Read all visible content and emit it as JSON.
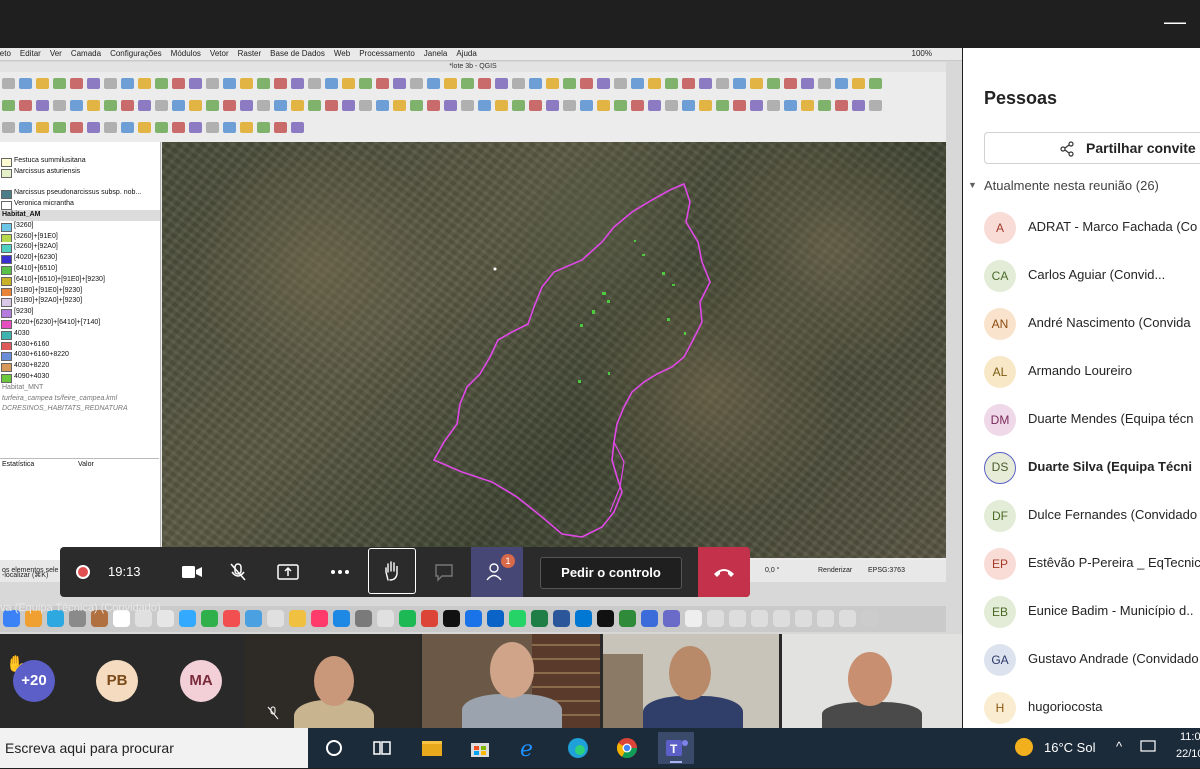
{
  "window": {
    "minimize_glyph": "—"
  },
  "mac_menu": {
    "items": [
      "ieto",
      "Editar",
      "Ver",
      "Camada",
      "Configurações",
      "Módulos",
      "Vetor",
      "Raster",
      "Base de Dados",
      "Web",
      "Processamento",
      "Janela",
      "Ajuda"
    ],
    "battery": "100%"
  },
  "qgis": {
    "title": "*lote 3b - QGIS",
    "layers": [
      {
        "label": "Festuca summilusitana",
        "color": "#fffbd0"
      },
      {
        "label": "Narcissus asturiensis",
        "color": "#e6f0c8"
      },
      {
        "label": "",
        "color": ""
      },
      {
        "label": "Narcissus pseudonarcissus subsp. nob...",
        "color": "#4a7f8a"
      },
      {
        "label": "Veronica micrantha",
        "color": "#ffffff"
      }
    ],
    "group_label": "Habitat_AM",
    "habitat_items": [
      {
        "label": "[3260]",
        "color": "#6cc6e8"
      },
      {
        "label": "[3260]+[91E0]",
        "color": "#b5d94a"
      },
      {
        "label": "[3260]+[92A0]",
        "color": "#4fd0c0"
      },
      {
        "label": "[4020]+[6230]",
        "color": "#3a2fd0"
      },
      {
        "label": "[6410]+[6510]",
        "color": "#5ac04a"
      },
      {
        "label": "[6410]+[6510]+[91E0]+[9230]",
        "color": "#c9b12a"
      },
      {
        "label": "[91B0]+[91E0]+[9230]",
        "color": "#e8833a"
      },
      {
        "label": "[91B0]+[92A0]+[9230]",
        "color": "#d9c7e8"
      },
      {
        "label": "[9230]",
        "color": "#b57ce0"
      },
      {
        "label": "4020+[6230]+[6410]+[7140]",
        "color": "#e64fbf"
      },
      {
        "label": "4030",
        "color": "#3fb3b0"
      },
      {
        "label": "4030+6160",
        "color": "#e05a5a"
      },
      {
        "label": "4030+6160+8220",
        "color": "#6a8fd8"
      },
      {
        "label": "4030+8220",
        "color": "#d89a5a"
      },
      {
        "label": "4090+4030",
        "color": "#6ac83a"
      }
    ],
    "extra_layers": [
      "Habitat_MNT",
      "turfeira_campea ts/feire_campea.kml",
      "DCRESINOS_HABITATS_REDNATURA"
    ],
    "stats_cols": [
      "Estatística",
      "Valor"
    ],
    "status": {
      "selected": "os elementos sele",
      "locator": "-localizar (⌘K)",
      "rotation": "0,0 °",
      "render": "Renderizar",
      "epsg": "EPSG:3763"
    }
  },
  "call": {
    "timer": "19:13",
    "request_control": "Pedir o controlo",
    "people_badge": "1",
    "presenter": "va (Equipa Técnica) (Convidado)"
  },
  "strip": {
    "overflow_count": "+20",
    "avatars": [
      {
        "initials": "PB",
        "bg": "#f5dcc0",
        "fg": "#7a4a1a"
      },
      {
        "initials": "MA",
        "bg": "#f3d0d8",
        "fg": "#7a2a3a"
      }
    ]
  },
  "panel": {
    "title": "Pessoas",
    "share_invite": "Partilhar convite",
    "in_meeting": "Atualmente nesta reunião (26)",
    "participants": [
      {
        "initials": "A",
        "name": "ADRAT - Marco Fachada (Co",
        "bg": "#f9dcd6",
        "fg": "#a33a2a",
        "bold": false
      },
      {
        "initials": "CA",
        "name": "Carlos Aguiar (Convid...",
        "bg": "#e3ecd6",
        "fg": "#4a6a2a",
        "bold": false
      },
      {
        "initials": "AN",
        "name": "André Nascimento (Convida",
        "bg": "#fae3cc",
        "fg": "#8a4a10",
        "bold": false
      },
      {
        "initials": "AL",
        "name": "Armando Loureiro",
        "bg": "#f8e8c8",
        "fg": "#7a5a10",
        "bold": false
      },
      {
        "initials": "DM",
        "name": "Duarte Mendes (Equipa técn",
        "bg": "#efd8e8",
        "fg": "#7a2a5a",
        "bold": false
      },
      {
        "initials": "DS",
        "name": "Duarte Silva (Equipa Técni",
        "bg": "#e6ecd8",
        "fg": "#4a5a2a",
        "bold": true
      },
      {
        "initials": "DF",
        "name": "Dulce Fernandes (Convidado",
        "bg": "#e3ecd6",
        "fg": "#4a6a2a",
        "bold": false
      },
      {
        "initials": "EP",
        "name": "Estêvão P-Pereira _ EqTecnic",
        "bg": "#f9dcd6",
        "fg": "#a33a2a",
        "bold": false
      },
      {
        "initials": "EB",
        "name": "Eunice Badim - Município d..",
        "bg": "#e3ecd6",
        "fg": "#4a6a2a",
        "bold": false
      },
      {
        "initials": "GA",
        "name": "Gustavo Andrade (Convidado",
        "bg": "#dde3ee",
        "fg": "#2a3a6a",
        "bold": false
      },
      {
        "initials": "H",
        "name": "hugoriocosta",
        "bg": "#faecd0",
        "fg": "#8a5a10",
        "bold": false
      }
    ]
  },
  "taskbar": {
    "search_placeholder": "Escreva aqui para procurar",
    "temperature": "16°C",
    "weather": "Sol",
    "time": "11:0",
    "date": "22/10/"
  }
}
